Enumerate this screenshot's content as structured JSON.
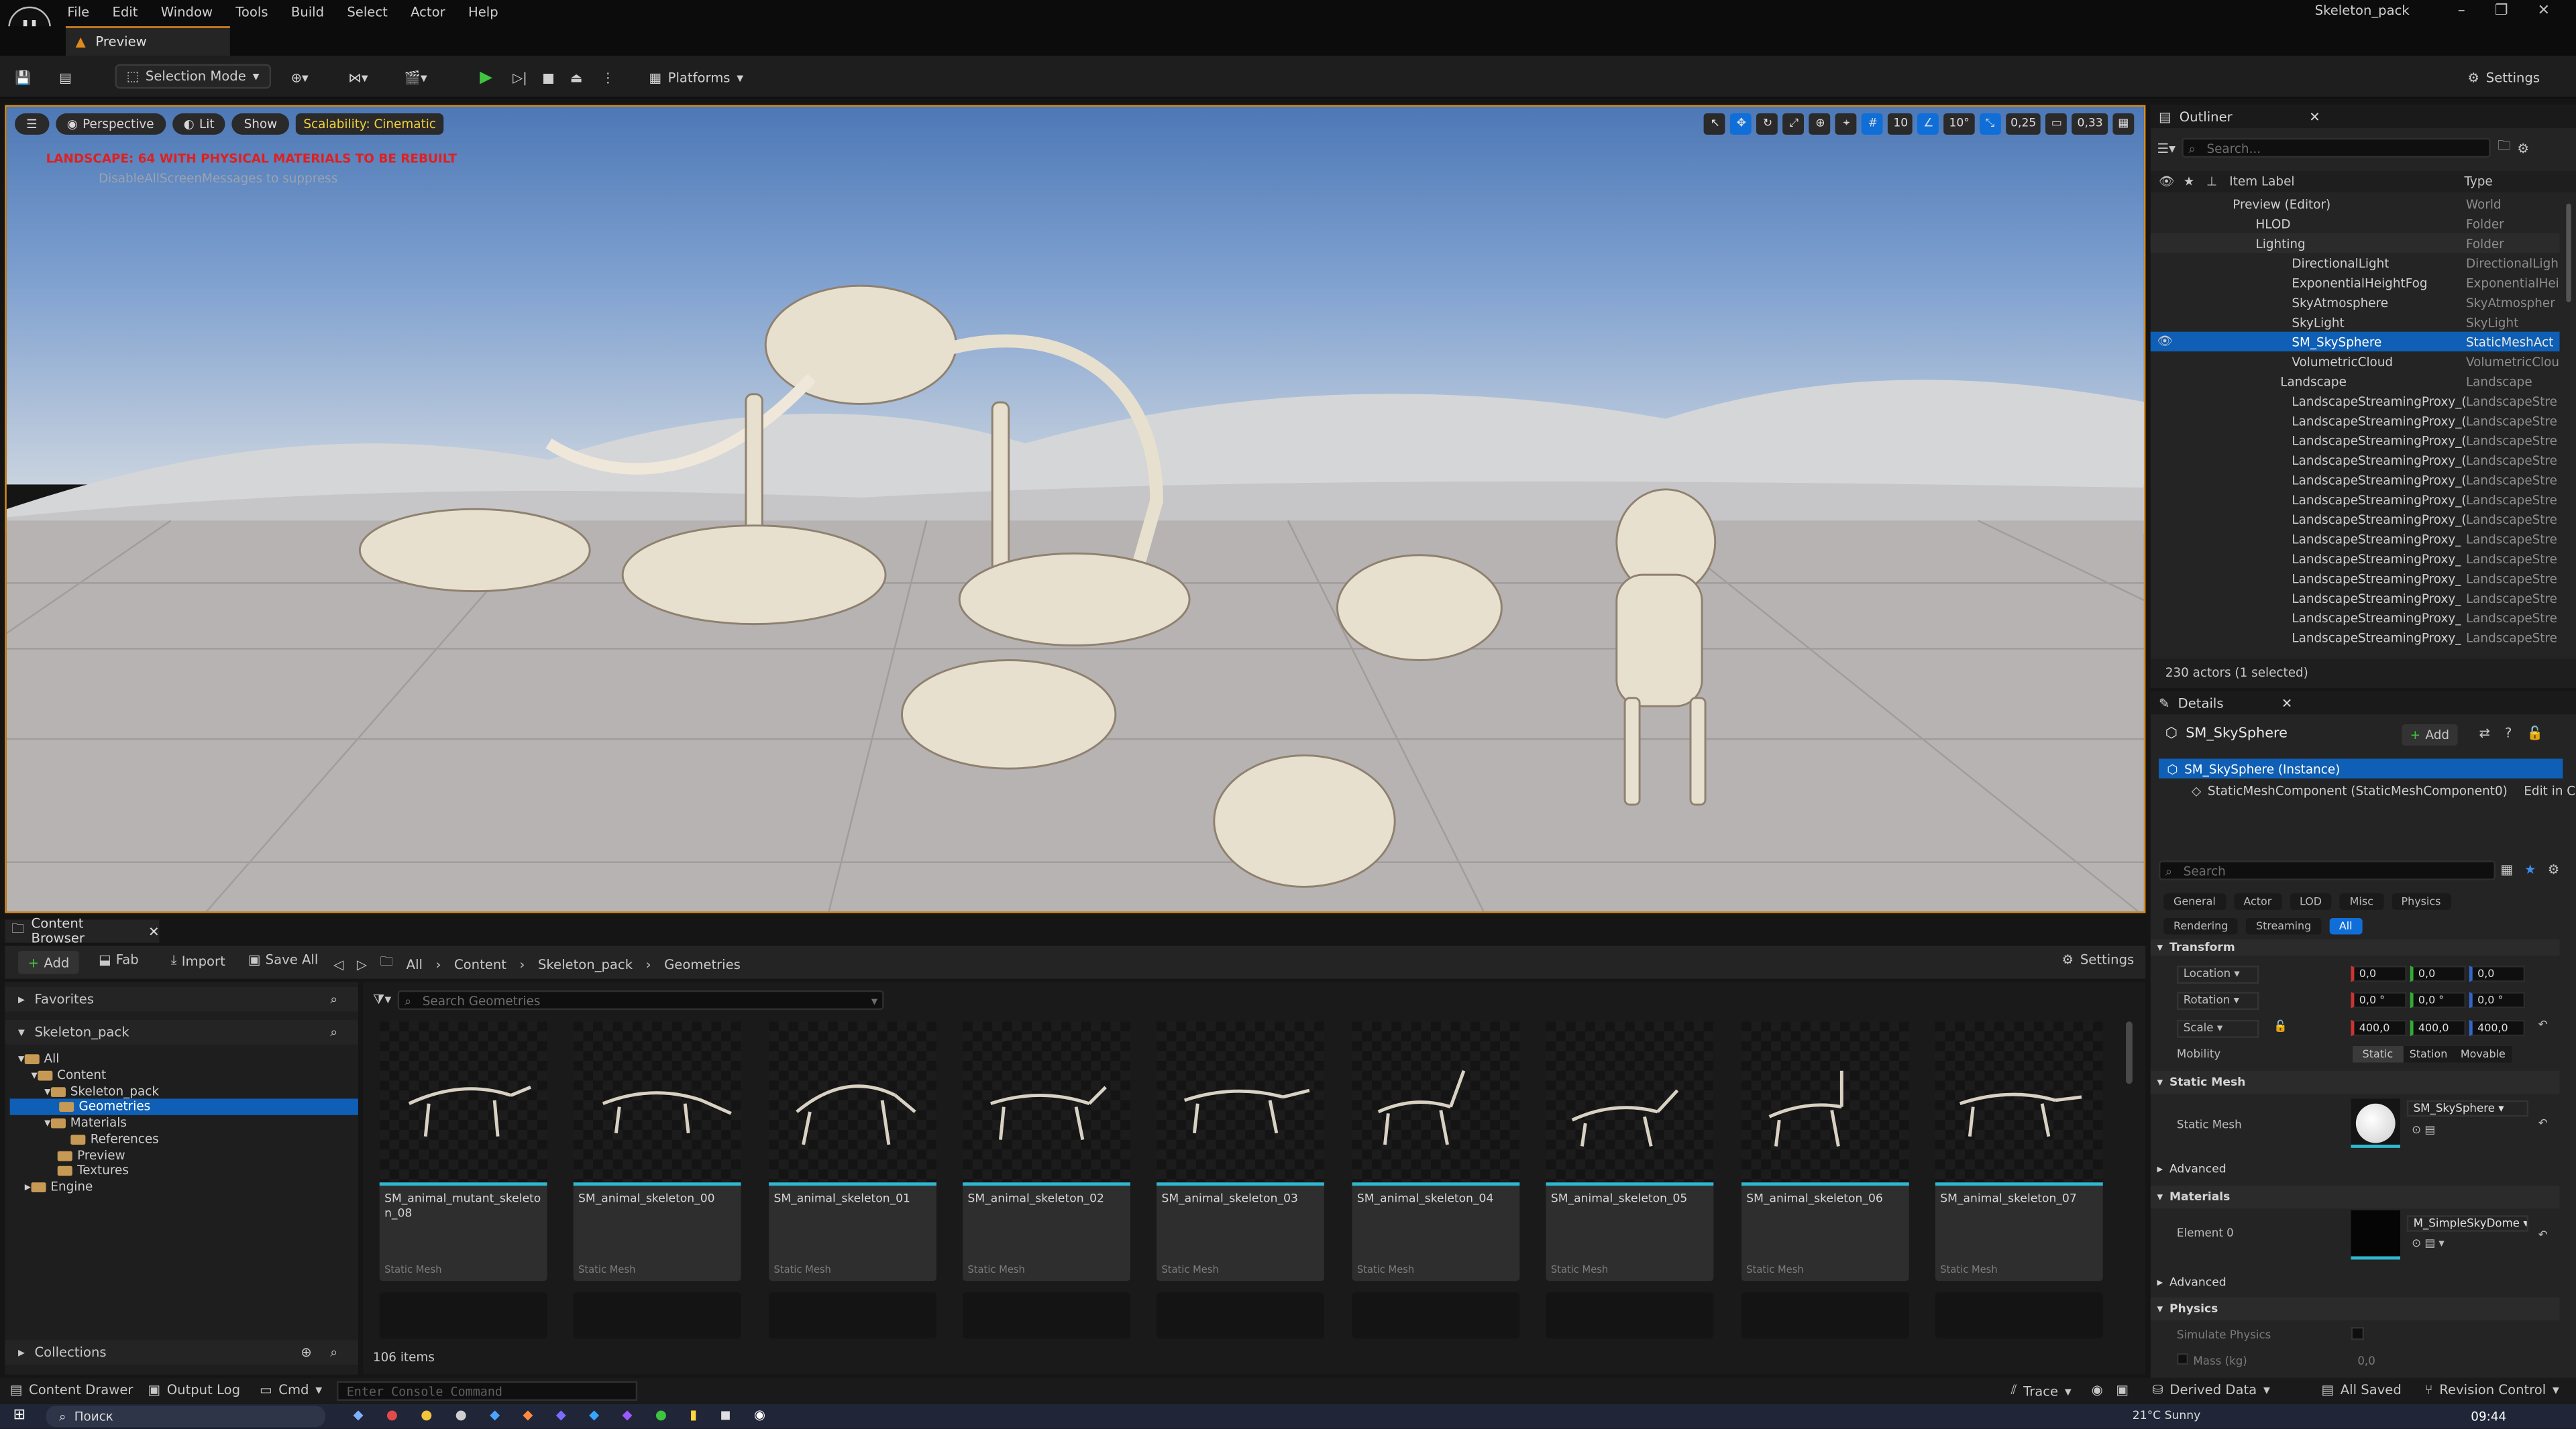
{
  "app": {
    "title": "Skeleton_pack",
    "logo_text": "U",
    "menu": [
      "File",
      "Edit",
      "Window",
      "Tools",
      "Build",
      "Select",
      "Actor",
      "Help"
    ],
    "window_buttons": [
      "–",
      "❐",
      "✕"
    ],
    "doc_tab": "Preview"
  },
  "toolbar": {
    "selection_mode": "Selection Mode",
    "platforms": "Platforms",
    "settings": "Settings"
  },
  "viewport": {
    "perspective": "Perspective",
    "lit": "Lit",
    "show": "Show",
    "scalability": "Scalability: Cinematic",
    "warning": "LANDSCAPE: 64  WITH PHYSICAL MATERIALS  TO BE REBUILT",
    "warning_hint": "DisableAllScreenMessages  to suppress",
    "grid_snap": "10",
    "rot_snap": "10°",
    "scale_snap": "0,25",
    "cam_speed": "0,33"
  },
  "outliner": {
    "tab": "Outliner",
    "search_placeholder": "Search...",
    "col_label": "Item Label",
    "col_type": "Type",
    "rows": [
      {
        "label": "Preview (Editor)",
        "type": "World"
      },
      {
        "label": "HLOD",
        "type": "Folder"
      },
      {
        "label": "Lighting",
        "type": "Folder"
      },
      {
        "label": "DirectionalLight",
        "type": "DirectionalLigh"
      },
      {
        "label": "ExponentialHeightFog",
        "type": "ExponentialHei"
      },
      {
        "label": "SkyAtmosphere",
        "type": "SkyAtmospher"
      },
      {
        "label": "SkyLight",
        "type": "SkyLight"
      },
      {
        "label": "SM_SkySphere",
        "type": "StaticMeshAct"
      },
      {
        "label": "VolumetricCloud",
        "type": "VolumetricClou"
      },
      {
        "label": "Landscape",
        "type": "Landscape"
      },
      {
        "label": "LandscapeStreamingProxy_(",
        "type": "LandscapeStre"
      },
      {
        "label": "LandscapeStreamingProxy_(",
        "type": "LandscapeStre"
      },
      {
        "label": "LandscapeStreamingProxy_(",
        "type": "LandscapeStre"
      },
      {
        "label": "LandscapeStreamingProxy_(",
        "type": "LandscapeStre"
      },
      {
        "label": "LandscapeStreamingProxy_(",
        "type": "LandscapeStre"
      },
      {
        "label": "LandscapeStreamingProxy_(",
        "type": "LandscapeStre"
      },
      {
        "label": "LandscapeStreamingProxy_(",
        "type": "LandscapeStre"
      },
      {
        "label": "LandscapeStreamingProxy_",
        "type": "LandscapeStre"
      },
      {
        "label": "LandscapeStreamingProxy_",
        "type": "LandscapeStre"
      },
      {
        "label": "LandscapeStreamingProxy_",
        "type": "LandscapeStre"
      },
      {
        "label": "LandscapeStreamingProxy_",
        "type": "LandscapeStre"
      },
      {
        "label": "LandscapeStreamingProxy_",
        "type": "LandscapeStre"
      },
      {
        "label": "LandscapeStreamingProxy_",
        "type": "LandscapeStre"
      }
    ],
    "status": "230 actors (1 selected)"
  },
  "details": {
    "tab": "Details",
    "actor": "SM_SkySphere",
    "add": "Add",
    "instance": "SM_SkySphere (Instance)",
    "component": "StaticMeshComponent (StaticMeshComponent0)",
    "edit_in": "Edit in C+",
    "search_placeholder": "Search",
    "filters": [
      "General",
      "Actor",
      "LOD",
      "Misc",
      "Physics"
    ],
    "filters2": [
      "Rendering",
      "Streaming",
      "All"
    ],
    "transform": "Transform",
    "location": "Location",
    "rotation": "Rotation",
    "scale": "Scale",
    "loc_vals": [
      "0,0",
      "0,0",
      "0,0"
    ],
    "rot_vals": [
      "0,0 °",
      "0,0 °",
      "0,0 °"
    ],
    "scale_vals": [
      "400,0",
      "400,0",
      "400,0"
    ],
    "mobility": "Mobility",
    "mobility_opts": [
      "Static",
      "Station",
      "Movable"
    ],
    "static_mesh_sect": "Static Mesh",
    "static_mesh_lbl": "Static Mesh",
    "static_mesh_val": "SM_SkySphere",
    "advanced": "Advanced",
    "materials_sect": "Materials",
    "element0": "Element 0",
    "material_val": "M_SimpleSkyDome",
    "advanced2": "Advanced",
    "physics_sect": "Physics",
    "simulate": "Simulate Physics",
    "mass": "Mass (kg)",
    "mass_val": "0,0"
  },
  "content_browser": {
    "tab": "Content Browser",
    "add": "Add",
    "fab": "Fab",
    "import": "Import",
    "save_all": "Save All",
    "breadcrumb": [
      "All",
      "Content",
      "Skeleton_pack",
      "Geometries"
    ],
    "settings": "Settings",
    "favorites": "Favorites",
    "root": "Skeleton_pack",
    "tree": [
      "All",
      "Content",
      "Skeleton_pack",
      "Geometries",
      "Materials",
      "References",
      "Preview",
      "Textures",
      "Engine"
    ],
    "collections": "Collections",
    "search_placeholder": "Search Geometries",
    "asset_type": "Static Mesh",
    "assets": [
      "SM_animal_mutant_skeleton_08",
      "SM_animal_skeleton_00",
      "SM_animal_skeleton_01",
      "SM_animal_skeleton_02",
      "SM_animal_skeleton_03",
      "SM_animal_skeleton_04",
      "SM_animal_skeleton_05",
      "SM_animal_skeleton_06",
      "SM_animal_skeleton_07"
    ],
    "count": "106 items"
  },
  "statusbar": {
    "content_drawer": "Content Drawer",
    "output_log": "Output Log",
    "cmd": "Cmd",
    "console_placeholder": "Enter Console Command",
    "trace": "Trace",
    "derived_data": "Derived Data",
    "all_saved": "All Saved",
    "revision_control": "Revision Control"
  },
  "taskbar": {
    "search": "Поиск",
    "weather": "21°C Sunny",
    "time": "09:44"
  },
  "colors": {
    "accent": "#0f6ed8",
    "viewport_border": "#d98d1c",
    "warning": "#e01f1f",
    "scalability": "#f2d23b",
    "asset_bar": "#2fb8d0"
  }
}
